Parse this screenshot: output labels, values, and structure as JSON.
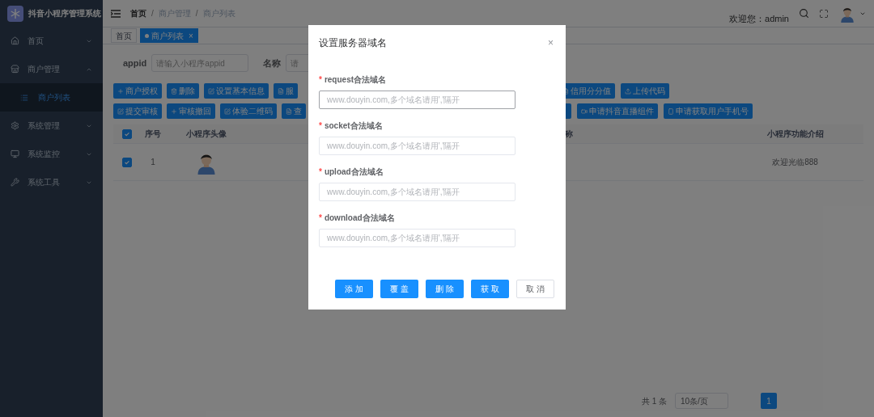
{
  "app": {
    "title": "抖音小程序管理系统"
  },
  "sidebar": {
    "items": [
      {
        "label": "首页",
        "kind": "home",
        "expanded": false,
        "selected": false
      },
      {
        "label": "商户管理",
        "kind": "shop",
        "expanded": true,
        "selected": false,
        "children": [
          {
            "label": "商户列表",
            "selected": true
          }
        ]
      },
      {
        "label": "系统管理",
        "kind": "gear",
        "expanded": false,
        "selected": false
      },
      {
        "label": "系统监控",
        "kind": "monitor",
        "expanded": false,
        "selected": false
      },
      {
        "label": "系统工具",
        "kind": "tool",
        "expanded": false,
        "selected": false
      }
    ]
  },
  "breadcrumb": {
    "separator": "/",
    "items": [
      "首页",
      "商户管理",
      "商户列表"
    ]
  },
  "user": {
    "greeting": "欢迎您：admin"
  },
  "tags": [
    {
      "label": "首页",
      "selected": false
    },
    {
      "label": "商户列表",
      "selected": true,
      "close": "×"
    }
  ],
  "filters": [
    {
      "label": "appid",
      "placeholder": "请输入小程序appid"
    },
    {
      "label": "名称",
      "placeholder": "请"
    }
  ],
  "toolbar_rows": [
    {
      "left": [
        {
          "label": "商户授权",
          "kind": "plus"
        },
        {
          "label": "删除",
          "kind": "trash"
        },
        {
          "label": "设置基本信息",
          "kind": "edit"
        },
        {
          "label": "服",
          "kind": "doc"
        }
      ],
      "right": [
        {
          "label": "信用分分值",
          "kind": "doc"
        },
        {
          "label": "上传代码",
          "kind": "upload"
        }
      ]
    },
    {
      "left": [
        {
          "label": "提交审核",
          "kind": "edit"
        },
        {
          "label": "审核撤回",
          "kind": "plus"
        },
        {
          "label": "体验二维码",
          "kind": "edit"
        },
        {
          "label": "查",
          "kind": "doc"
        }
      ],
      "right": [
        {
          "kind": "blank"
        },
        {
          "label": "申请抖音直播组件",
          "kind": "video"
        },
        {
          "label": "申请获取用户手机号",
          "kind": "phone"
        }
      ]
    }
  ],
  "table": {
    "all_checked": true,
    "columns": [
      "序号",
      "小程序头像",
      "称",
      "小程序功能介绍"
    ],
    "rows": [
      {
        "checked": true,
        "index": "1",
        "intro": "欢迎光临888"
      }
    ]
  },
  "pagination": {
    "total": "共 1 条",
    "page_size": "10条/页",
    "pages": [
      {
        "label": "1",
        "selected": true
      }
    ]
  },
  "dialog": {
    "title": "设置服务器域名",
    "close": "×",
    "fields": [
      {
        "mark": "*",
        "label": "request合法域名",
        "placeholder": "www.douyin.com,多个域名请用','隔开",
        "focused": true
      },
      {
        "mark": "*",
        "label": "socket合法域名",
        "placeholder": "www.douyin.com,多个域名请用','隔开",
        "focused": false
      },
      {
        "mark": "*",
        "label": "upload合法域名",
        "placeholder": "www.douyin.com,多个域名请用','隔开",
        "focused": false
      },
      {
        "mark": "*",
        "label": "download合法域名",
        "placeholder": "www.douyin.com,多个域名请用','隔开",
        "focused": false
      }
    ],
    "buttons": [
      {
        "label": "添 加",
        "kind": "primary"
      },
      {
        "label": "覆 盖",
        "kind": "primary"
      },
      {
        "label": "删 除",
        "kind": "primary"
      },
      {
        "label": "获 取",
        "kind": "primary"
      },
      {
        "label": "取 消",
        "kind": "plain"
      }
    ]
  }
}
